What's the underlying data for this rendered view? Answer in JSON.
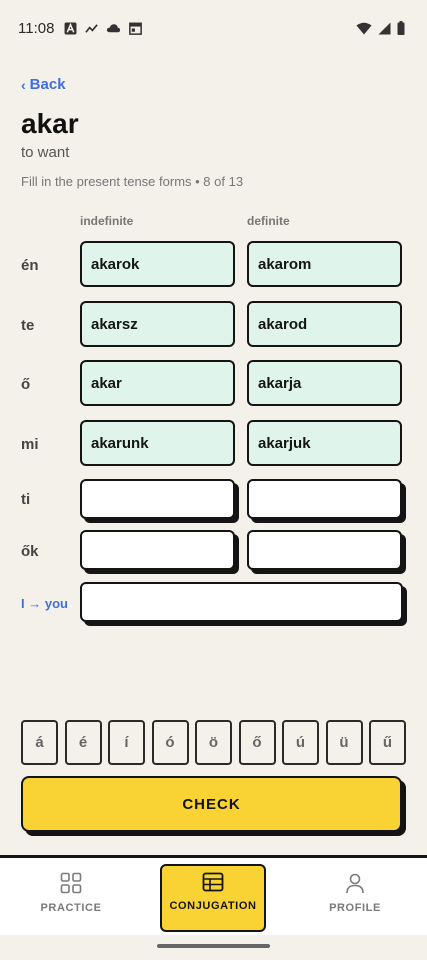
{
  "status_bar": {
    "time": "11:08",
    "icons": [
      "text-a-icon",
      "trend-icon",
      "cloud-icon",
      "calendar-icon",
      "wifi-icon",
      "signal-icon",
      "battery-icon"
    ]
  },
  "back": {
    "label": "Back"
  },
  "verb": {
    "title": "akar",
    "meaning": "to want",
    "instruction": "Fill in the present tense forms • 8 of 13"
  },
  "columns": {
    "indefinite": "indefinite",
    "definite": "definite"
  },
  "rows": [
    {
      "pronoun": "én",
      "indefinite": "akarok",
      "definite": "akarom"
    },
    {
      "pronoun": "te",
      "indefinite": "akarsz",
      "definite": "akarod"
    },
    {
      "pronoun": "ő",
      "indefinite": "akar",
      "definite": "akarja"
    },
    {
      "pronoun": "mi",
      "indefinite": "akarunk",
      "definite": "akarjuk"
    },
    {
      "pronoun": "ti",
      "indefinite": "",
      "definite": ""
    },
    {
      "pronoun": "ők",
      "indefinite": "",
      "definite": ""
    }
  ],
  "special_row": {
    "pronoun": "I → you",
    "value": ""
  },
  "accents": [
    "á",
    "é",
    "í",
    "ó",
    "ö",
    "ő",
    "ú",
    "ü",
    "ű"
  ],
  "check_button": {
    "label": "CHECK"
  },
  "nav": {
    "practice": "PRACTICE",
    "conjugation": "CONJUGATION",
    "profile": "PROFILE",
    "active": "conjugation"
  },
  "colors": {
    "background": "#f4f1ea",
    "accent_blue": "#3f6fe3",
    "filled_cell": "#dff4ea",
    "primary_yellow": "#f9d234"
  }
}
